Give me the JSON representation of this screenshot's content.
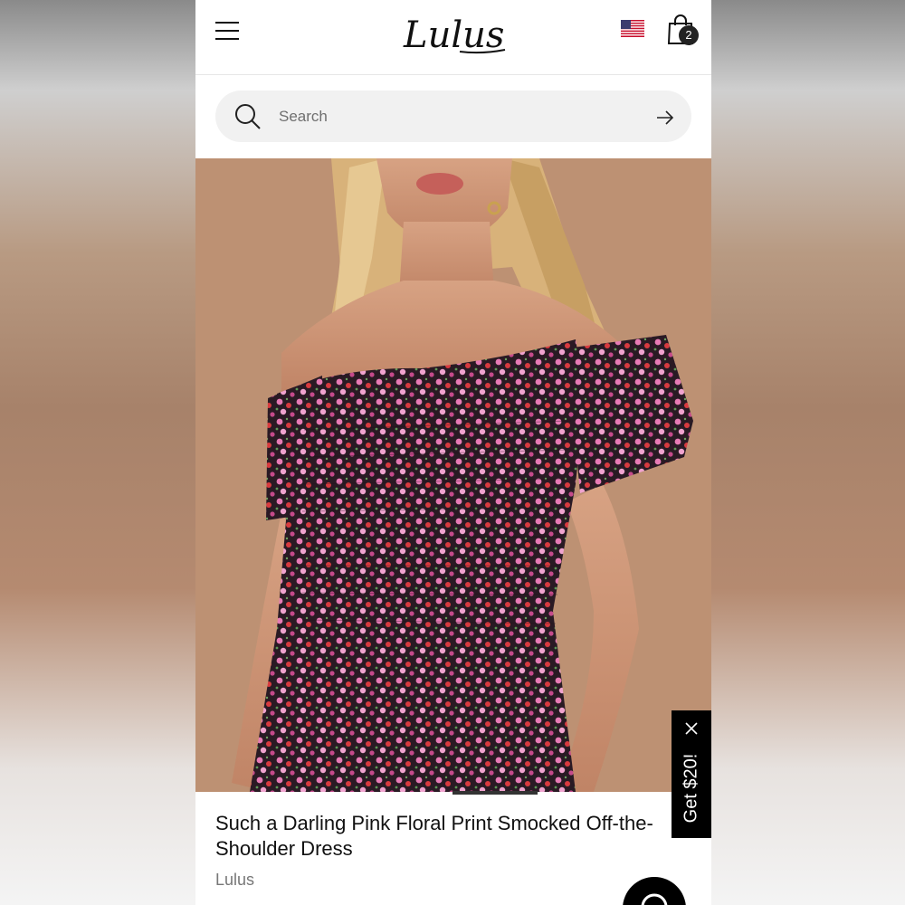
{
  "colors": {
    "header_bg": "#ffffff",
    "search_bg": "#f1f1f1",
    "accent_black": "#000000",
    "badge_bg": "#222222",
    "hero_bg": "#b98c6f"
  },
  "header": {
    "logo_text": "Lulus",
    "menu_icon": "hamburger-menu-icon",
    "flag_icon": "us-flag-icon",
    "cart": {
      "icon": "shopping-bag-icon",
      "count": "2"
    }
  },
  "search": {
    "placeholder": "Search",
    "value": "",
    "icon": "search-icon",
    "submit_icon": "arrow-right-icon"
  },
  "hero": {
    "image": "model-in-floral-off-shoulder-dress"
  },
  "promo_tab": {
    "label": "Get $20!",
    "close_icon": "close-icon"
  },
  "product": {
    "title": "Such a Darling Pink Floral Print Smocked Off-the-Shoulder Dress",
    "brand": "Lulus"
  },
  "chat": {
    "icon": "chat-bubble-icon"
  }
}
